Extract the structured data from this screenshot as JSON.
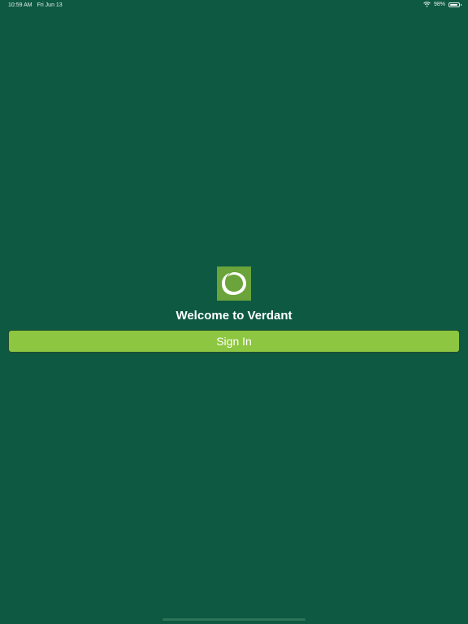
{
  "status_bar": {
    "time": "10:59 AM",
    "date": "Fri Jun 13",
    "battery_percent": "98%",
    "battery_level": 0.98,
    "wifi_icon": "wifi-icon",
    "battery_icon": "battery-icon"
  },
  "welcome": {
    "title": "Welcome to Verdant",
    "sign_in_label": "Sign In"
  },
  "colors": {
    "background": "#0d5942",
    "logo_background": "#6aa43a",
    "button_background": "#8dc640",
    "text": "#ffffff"
  }
}
